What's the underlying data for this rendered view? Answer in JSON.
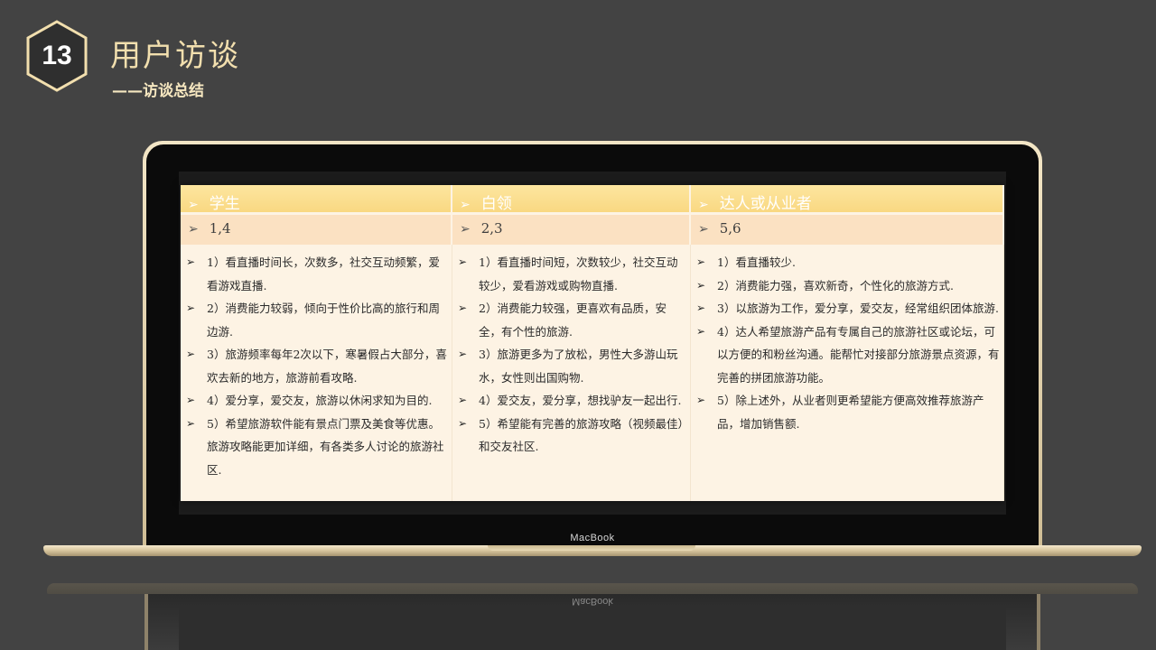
{
  "header": {
    "section_number": "13",
    "title": "用户访谈",
    "subtitle": "——访谈总结"
  },
  "laptop": {
    "brand": "MacBook"
  },
  "table": {
    "columns": [
      {
        "heading": "学生",
        "numbers": "1,4",
        "items": [
          "1）看直播时间长，次数多，社交互动频繁，爱看游戏直播.",
          "2）消费能力较弱，倾向于性价比高的旅行和周边游.",
          "3）旅游频率每年2次以下，寒暑假占大部分，喜欢去新的地方，旅游前看攻略.",
          "4）爱分享，爱交友，旅游以休闲求知为目的.",
          "5）希望旅游软件能有景点门票及美食等优惠。旅游攻略能更加详细，有各类多人讨论的旅游社区."
        ]
      },
      {
        "heading": "白领",
        "numbers": "2,3",
        "items": [
          "1）看直播时间短，次数较少，社交互动较少，爱看游戏或购物直播.",
          "2）消费能力较强，更喜欢有品质，安全，有个性的旅游.",
          "3）旅游更多为了放松，男性大多游山玩水，女性则出国购物.",
          "4）爱交友，爱分享，想找驴友一起出行.",
          "5）希望能有完善的旅游攻略（视频最佳）和交友社区."
        ]
      },
      {
        "heading": "达人或从业者",
        "numbers": "5,6",
        "items": [
          "1）看直播较少.",
          "2）消费能力强，喜欢新奇，个性化的旅游方式.",
          "3）以旅游为工作，爱分享，爱交友，经常组织团体旅游.",
          "4）达人希望旅游产品有专属自己的旅游社区或论坛，可以方便的和粉丝沟通。能帮忙对接部分旅游景点资源，有完善的拼团旅游功能。",
          "5）除上述外，从业者则更希望能方便高效推荐旅游产品，增加销售额."
        ]
      }
    ]
  },
  "colors": {
    "background": "#434343",
    "gold_accent": "#f2dfae",
    "header_row": "#f9d882",
    "number_row": "#fbe1c2",
    "body_fill": "#fdf3e4"
  },
  "icons": {
    "bullet": "arrow-bullet-icon",
    "badge": "hexagon-badge-icon"
  }
}
